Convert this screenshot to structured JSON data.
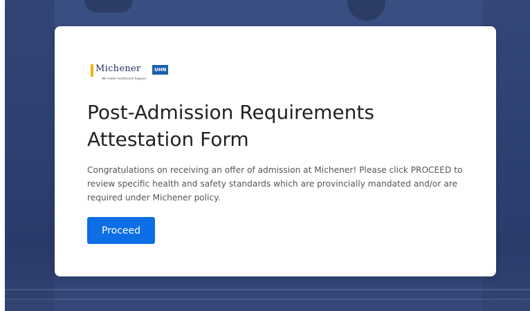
{
  "logo": {
    "name": "Michener",
    "badge": "UHN",
    "tagline": "We make healthcare happen"
  },
  "page": {
    "title": "Post-Admission Requirements Attestation Form",
    "description": "Congratulations on receiving an offer of admission at Michener! Please click PROCEED to review specific health and safety standards which are provincially mandated and/or are required under Michener policy.",
    "proceed_label": "Proceed"
  },
  "colors": {
    "accent": "#0d6ee6",
    "brand_navy": "#1f2d5c",
    "brand_gold": "#f2b300",
    "background": "#33497c"
  }
}
